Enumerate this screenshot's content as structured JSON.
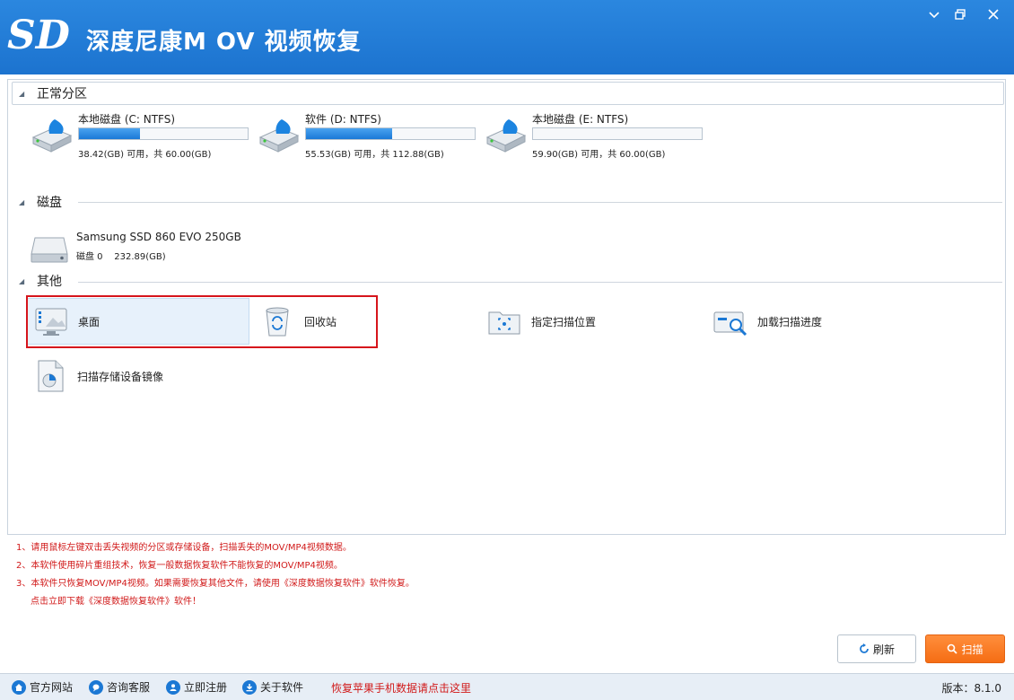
{
  "app": {
    "title": "深度尼康M OV 视频恢复",
    "logo_text": "SD"
  },
  "sections": {
    "partitions": "正常分区",
    "disks": "磁盘",
    "others": "其他"
  },
  "partitions": [
    {
      "name": "本地磁盘 (C: NTFS)",
      "info": "38.42(GB) 可用，共 60.00(GB)",
      "used_fraction": 0.36
    },
    {
      "name": "软件 (D: NTFS)",
      "info": "55.53(GB) 可用，共 112.88(GB)",
      "used_fraction": 0.51
    },
    {
      "name": "本地磁盘 (E: NTFS)",
      "info": "59.90(GB) 可用，共 60.00(GB)",
      "used_fraction": 0.0
    }
  ],
  "disk": {
    "name": "Samsung SSD 860 EVO 250GB",
    "info": "磁盘 0    232.89(GB)"
  },
  "others": [
    {
      "label": "桌面",
      "icon": "desktop-icon",
      "selected": true
    },
    {
      "label": "回收站",
      "icon": "recycle-bin-icon",
      "selected": false
    },
    {
      "label": "指定扫描位置",
      "icon": "scan-location-icon",
      "selected": false
    },
    {
      "label": "加载扫描进度",
      "icon": "load-progress-icon",
      "selected": false
    },
    {
      "label": "扫描存储设备镜像",
      "icon": "disk-image-icon",
      "selected": false
    }
  ],
  "notes": [
    "1、请用鼠标左键双击丢失视频的分区或存储设备，扫描丢失的MOV/MP4视频数据。",
    "2、本软件使用碎片重组技术，恢复一般数据恢复软件不能恢复的MOV/MP4视频。",
    "3、本软件只恢复MOV/MP4视频。如果需要恢复其他文件，请使用《深度数据恢复软件》软件恢复。",
    "点击立即下载《深度数据恢复软件》软件！"
  ],
  "buttons": {
    "refresh": "刷新",
    "scan": "扫描"
  },
  "statusbar": {
    "website": "官方网站",
    "support": "咨询客服",
    "register": "立即注册",
    "about": "关于软件",
    "apple_link": "恢复苹果手机数据请点击这里",
    "version": "版本：8.1.0"
  },
  "colors": {
    "titlebar": "#1f78d3",
    "progress": "#1a78d6",
    "scan_button": "#f56d14",
    "note_red": "#d11a1a",
    "highlight": "#d6151c"
  }
}
